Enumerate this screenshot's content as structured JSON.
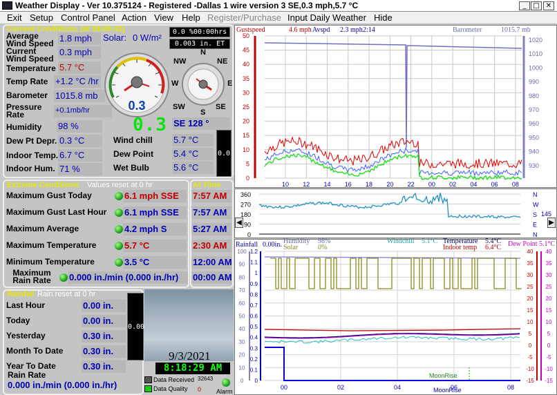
{
  "window": {
    "title": "Weather Display - Ver 10.375124 - Registered  -Dallas 1 wire version 3  SE,0.3 mph,5.7 °C",
    "minimize": "_",
    "maximize": "□",
    "close": "✕",
    "app_icon": "weather-app-icon"
  },
  "menu": [
    {
      "label": "Exit",
      "enabled": true
    },
    {
      "label": "Setup",
      "enabled": true
    },
    {
      "label": "Control Panel",
      "enabled": true
    },
    {
      "label": "Action",
      "enabled": true
    },
    {
      "label": "View",
      "enabled": true
    },
    {
      "label": "Help",
      "enabled": true
    },
    {
      "label": "Register/Purchase",
      "enabled": false
    },
    {
      "label": "Input Daily Weather",
      "enabled": true
    },
    {
      "label": "Hide",
      "enabled": true
    }
  ],
  "current": {
    "title": "Current Conditions, (at 08:05:42)",
    "avg_wind_label": "Average Wind Speed",
    "avg_wind_value": "1.8 mph",
    "solar_label": "Solar:",
    "solar_value": "0 W/m²",
    "current_wind_label": "Current Wind Speed",
    "current_wind_value": "0.3 mph",
    "temp_label": "Temperature",
    "temp_value": "5.7 °C",
    "temp_rate_label": "Temp Rate",
    "temp_rate_value": "+1.2 °C /hr",
    "baro_label": "Barometer",
    "baro_value": "1015.8 mb",
    "pressure_rate_label": "Pressure Rate",
    "pressure_rate_value": "+0.1mb/hr",
    "humidity_label": "Humidity",
    "humidity_value": "98 %",
    "dewpt_depr_label": "Dew Pt Depr.",
    "dewpt_depr_value": "0.3 °C",
    "indoor_temp_label": "Indoor Temp.",
    "indoor_temp_value": "6.7 °C",
    "indoor_hum_label": "Indoor Hum.",
    "indoor_hum_value": "71 %",
    "windchill_label": "Wind chill",
    "windchill_value": "5.7 °C",
    "dewpoint_label": "Dew Point",
    "dewpoint_value": "5.4 °C",
    "wetbulb_label": "Wet Bulb",
    "wetbulb_value": "5.6 °C",
    "timer_hrs": "0.0 %00:00hrs",
    "et": "0.003 in. ET",
    "gauge_value": "0.3",
    "digital_speed": "0.3",
    "wind_dir": "SE  128 °",
    "side_lcd": "0.0",
    "compass": {
      "n": "N",
      "ne": "NE",
      "e": "E",
      "se": "SE",
      "s": "S",
      "sw": "SW",
      "w": "W",
      "nw": "NW"
    }
  },
  "extreme": {
    "title": "Extreme Conditions",
    "reset": "Values reset at 0 hr",
    "at_time": "At Time",
    "rows": [
      {
        "label": "Maximum Gust Today",
        "value": "6.1 mph SSE",
        "time": "7:57 AM",
        "value_color": "#c00000",
        "time_color": "#c00000"
      },
      {
        "label": "Maximum Gust Last Hour",
        "value": "6.1 mph SSE",
        "time": "7:57 AM",
        "value_color": "#0000b4",
        "time_color": "#0000b4"
      },
      {
        "label": "Maximum Average",
        "value": "4.2 mph   S",
        "time": "5:27 AM",
        "value_color": "#0000b4",
        "time_color": "#0000b4"
      },
      {
        "label": "Maximum Temperature",
        "value": "5.7 °C",
        "time": "2:30 AM",
        "value_color": "#c00000",
        "time_color": "#c00000"
      },
      {
        "label": "Minimum Temperature",
        "value": "3.5 °C",
        "time": "12:00 AM",
        "value_color": "#0000b4",
        "time_color": "#0000b4"
      },
      {
        "label": "Maximum Rain Rate",
        "value": "0.000 in./min (0.000 in./hr)",
        "time": "00:00 AM",
        "value_color": "#0000b4",
        "time_color": "#0000b4"
      }
    ]
  },
  "rainfall": {
    "title": "Rainfall",
    "reset": "Rain reset at 0 hr",
    "rows": [
      {
        "label": "Last Hour",
        "value": "0.00 in."
      },
      {
        "label": "Today",
        "value": "0.00 in."
      },
      {
        "label": "Yesterday",
        "value": "0.30 in."
      },
      {
        "label": "Month To Date",
        "value": "0.30 in."
      },
      {
        "label": "Year To Date",
        "value": "0.30 in."
      }
    ],
    "rain_rate_label": "Rain Rate",
    "rain_rate_value": "0.000 in./min (0.000 in./hr)",
    "side_lcd": "0.00"
  },
  "status": {
    "date": "9/3/2021",
    "time": "8:18:29 AM",
    "data_received_label": "Data Received",
    "data_received_count": "32643",
    "data_quality_label": "Data Quality",
    "data_quality_value": "0",
    "alarm_label": "Alarm"
  },
  "graph1": {
    "hdr_gust": "Gustspeed",
    "hdr_gust_val": "4.6 mph",
    "hdr_avsp": "Avspd",
    "hdr_avsp_val": "2.3 mph",
    "hdr_avsp_time": "2:14",
    "hdr_baro": "Barometer",
    "hdr_baro_val": "1015.7 mb",
    "yleft": [
      "50",
      "45",
      "40",
      "35",
      "30",
      "25",
      "20",
      "15",
      "10",
      "5",
      "0"
    ],
    "yright": [
      "1020",
      "1010",
      "1000",
      "990",
      "980",
      "970",
      "960",
      "950",
      "940",
      "930"
    ],
    "xticks": [
      "10",
      "12",
      "14",
      "16",
      "18",
      "20",
      "22",
      "00",
      "02",
      "04",
      "06",
      "08"
    ]
  },
  "graph2": {
    "yleft": [
      "360",
      "270",
      "180",
      "90",
      "0"
    ],
    "yright": [
      "N",
      "W",
      "S",
      "E",
      "N"
    ],
    "right_val": "145",
    "left_arrow": "◀",
    "right_arrow": "▶"
  },
  "graph3": {
    "hdr_rain": "Rainfall",
    "hdr_rain_val": "0.00in.",
    "hdr_hum": "Humidity",
    "hdr_hum_val": "98%",
    "hdr_solar": "Solar",
    "hdr_solar_val": "0%",
    "hdr_wc": "Windchill",
    "hdr_wc_val": "5.1°C",
    "hdr_temp": "Temperature",
    "hdr_temp_val": "5.4°C",
    "hdr_indoor": "Indoor temp",
    "hdr_indoor_val": "6.4°C",
    "hdr_dew": "Dew Point",
    "hdr_dew_val": "5.1°C",
    "yleft1": [
      "100",
      "90",
      "80",
      "70",
      "60",
      "50",
      "40",
      "30",
      "20",
      "10",
      "0"
    ],
    "yleft2": [
      "1.2",
      "1.1",
      "1",
      "0.9",
      "0.8",
      "0.7",
      "0.6",
      "0.5",
      "0.4",
      "0.3",
      "0.2",
      "0.1",
      "0"
    ],
    "yright1": [
      "40",
      "35",
      "30",
      "25",
      "20",
      "15",
      "10",
      "5",
      "0",
      "-5",
      "-10",
      "-15"
    ],
    "yright2": [
      "40",
      "35",
      "30",
      "25",
      "20",
      "15",
      "10",
      "5",
      "0",
      "-5",
      "-10",
      "-15"
    ],
    "xticks": [
      "00",
      "02",
      "04",
      "06",
      "08"
    ],
    "moonrise": "MoonRise",
    "moonrise2": "MoonRise"
  }
}
